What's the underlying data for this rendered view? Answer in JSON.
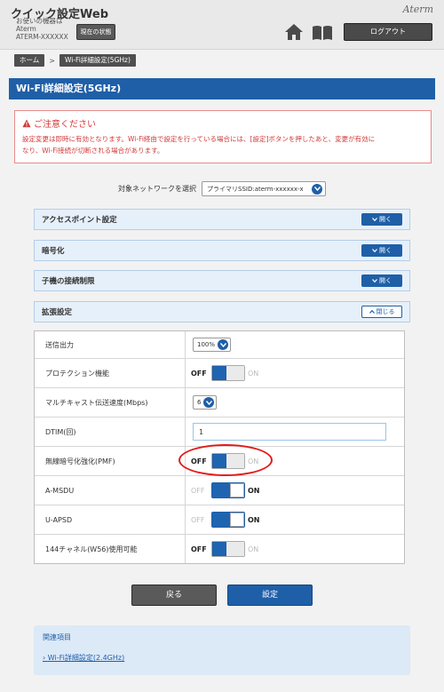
{
  "header": {
    "app_title": "クイック設定Web",
    "device_lines": [
      "お使いの機器は",
      "Aterm",
      "ATERM-XXXXXX"
    ],
    "status_button": "現在の状態",
    "brand": "Aterm",
    "home_icon": "home-icon",
    "manual_icon": "book-icon",
    "logout_button": "ログアウト"
  },
  "breadcrumb": {
    "home": "ホーム",
    "separator": ">",
    "current": "Wi-Fi詳細設定(5GHz)"
  },
  "page_title": "Wi-Fi詳細設定(5GHz)",
  "caution": {
    "title": "ご注意ください",
    "lines": [
      "設定変更は即時に有効となります。Wi-Fi経由で設定を行っている場合には、[設定]ボタンを押したあと、変更が有効に",
      "なり、Wi-Fi接続が切断される場合があります。"
    ]
  },
  "network_select": {
    "label": "対象ネットワークを選択",
    "value": "プライマリSSID:aterm-xxxxxx-x"
  },
  "sections": [
    {
      "title": "アクセスポイント設定",
      "button": "開く"
    },
    {
      "title": "暗号化",
      "button": "開く"
    },
    {
      "title": "子機の接続制限",
      "button": "開く"
    },
    {
      "title": "拡張設定",
      "button": "閉じる"
    }
  ],
  "settings": {
    "tx_power": {
      "label": "送信出力",
      "value": "100%"
    },
    "protection": {
      "label": "プロテクション機能",
      "state": "OFF"
    },
    "multicast": {
      "label": "マルチキャスト伝送速度(Mbps)",
      "value": "6"
    },
    "dtim": {
      "label": "DTIM(回)",
      "value": "1"
    },
    "pmf": {
      "label": "無線暗号化強化(PMF)",
      "state": "OFF"
    },
    "amsdu": {
      "label": "A-MSDU",
      "state": "ON"
    },
    "uapsd": {
      "label": "U-APSD",
      "state": "ON"
    },
    "ch144": {
      "label": "144チャネル(W56)使用可能",
      "state": "OFF"
    }
  },
  "toggle_labels": {
    "off": "OFF",
    "on": "ON"
  },
  "buttons": {
    "back": "戻る",
    "apply": "設定"
  },
  "related": {
    "title": "関連項目",
    "link": "Wi-Fi詳細設定(2.4GHz)"
  },
  "colors": {
    "primary": "#1f5fa8",
    "warning": "#d23a3a",
    "highlight": "#e21c1c"
  }
}
